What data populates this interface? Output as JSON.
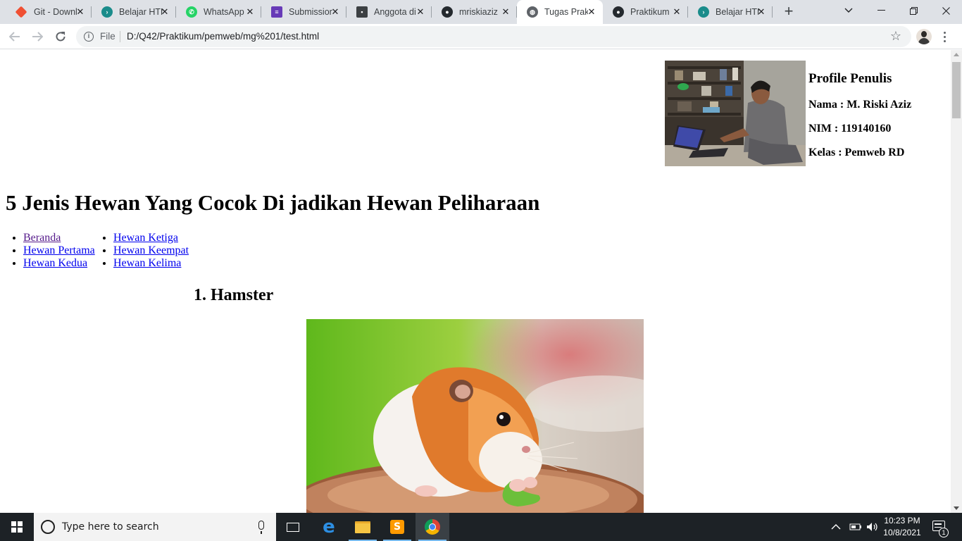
{
  "browser": {
    "tabs": [
      {
        "title": "Git - Downloads",
        "icon": "git-icon",
        "color": "#f05033",
        "glyph": "◆"
      },
      {
        "title": "Belajar HTML",
        "icon": "dicoding-icon",
        "color": "#1a8c8b",
        "glyph": "●"
      },
      {
        "title": "WhatsApp",
        "icon": "whatsapp-icon",
        "color": "#25d366",
        "glyph": "●"
      },
      {
        "title": "Submission",
        "icon": "form-icon",
        "color": "#673ab7",
        "glyph": "■"
      },
      {
        "title": "Anggota di",
        "icon": "contact-card-icon",
        "color": "#3c4043",
        "glyph": "■"
      },
      {
        "title": "mriskiaziz",
        "icon": "github-icon",
        "color": "#24292e",
        "glyph": "●"
      },
      {
        "title": "Tugas Praktikum",
        "icon": "globe-icon",
        "color": "#5f6368",
        "glyph": "●"
      },
      {
        "title": "Praktikum",
        "icon": "github-icon",
        "color": "#24292e",
        "glyph": "●"
      },
      {
        "title": "Belajar HTML",
        "icon": "dicoding-icon",
        "color": "#1a8c8b",
        "glyph": "●"
      }
    ],
    "active_tab_index": 6,
    "new_tab_glyph": "+",
    "close_glyph": "✕",
    "scheme_label": "File",
    "url": "D:/Q42/Praktikum/pemweb/mg%201/test.html"
  },
  "page": {
    "profile": {
      "title": "Profile Penulis",
      "name": "Nama : M. Riski Aziz",
      "nim": "NIM : 119140160",
      "kelas": "Kelas : Pemweb RD"
    },
    "heading": "5 Jenis Hewan Yang Cocok Di jadikan Hewan Peliharaan",
    "nav_col1": [
      "Beranda",
      "Hewan Pertama",
      "Hewan Kedua"
    ],
    "nav_col2": [
      "Hewan Ketiga",
      "Hewan Keempat",
      "Hewan Kelima"
    ],
    "section_title": "1. Hamster"
  },
  "taskbar": {
    "search_placeholder": "Type here to search",
    "time": "10:23 PM",
    "date": "10/8/2021",
    "notification_count": "1"
  }
}
